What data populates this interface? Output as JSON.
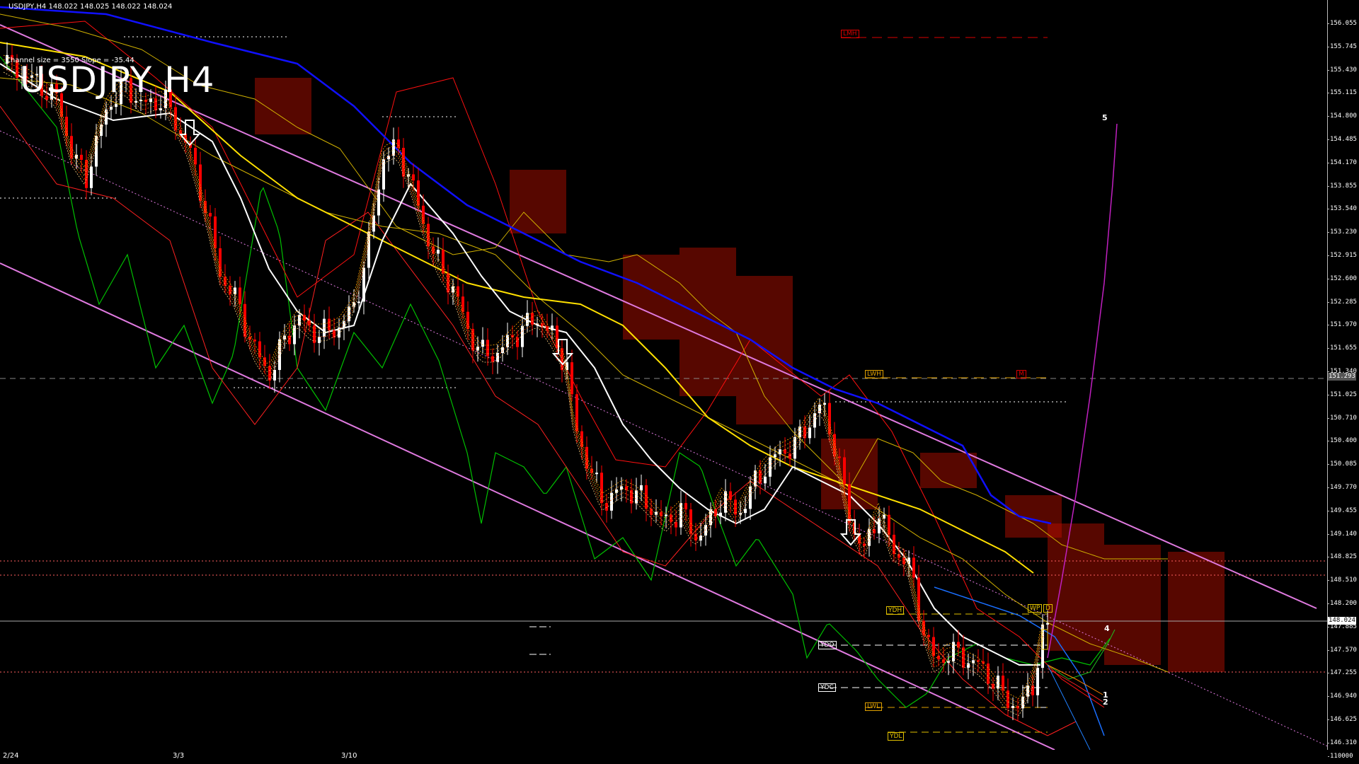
{
  "header": {
    "symbol_info": "USDJPY,H4  148.022 148.025 148.022 148.024"
  },
  "title": "USDJPY H4",
  "channel_info": "Channel size = 3550 Slope = -35.44",
  "price_axis": {
    "ticks": [
      "156.055",
      "155.745",
      "155.430",
      "155.115",
      "154.800",
      "154.485",
      "154.170",
      "153.855",
      "153.540",
      "153.230",
      "152.915",
      "152.600",
      "152.285",
      "151.970",
      "151.655",
      "151.340",
      "151.025",
      "150.710",
      "150.400",
      "150.085",
      "149.770",
      "149.455",
      "149.140",
      "148.825",
      "148.510",
      "148.200",
      "147.885",
      "147.570",
      "147.255",
      "146.940",
      "146.625",
      "146.310",
      "110000"
    ],
    "current_price": "148.024",
    "marked_price": "151.293"
  },
  "time_axis": {
    "labels": [
      "2/24",
      "3/3",
      "3/10"
    ]
  },
  "level_labels": {
    "lmh": "LMH",
    "lwh": "LWH",
    "ydh": "YDH",
    "ydo": "YDO",
    "ydc": "YDC",
    "lwl": "LWL",
    "ydl": "YDL",
    "m": "M",
    "wp": "WP",
    "d": "D"
  },
  "wave_labels": [
    "5",
    "4",
    "1",
    "2"
  ],
  "colors": {
    "background": "#000000",
    "channel": "#e07ae0",
    "bull_candle": "#ffffff",
    "bear_candle": "#ff0000",
    "ma_blue": "#1010ff",
    "ma_yellow": "#ffe000",
    "ma_white": "#ffffff",
    "cloud": "#c01000",
    "rsi_green": "#00c000",
    "projection_magenta": "#c020c0"
  }
}
